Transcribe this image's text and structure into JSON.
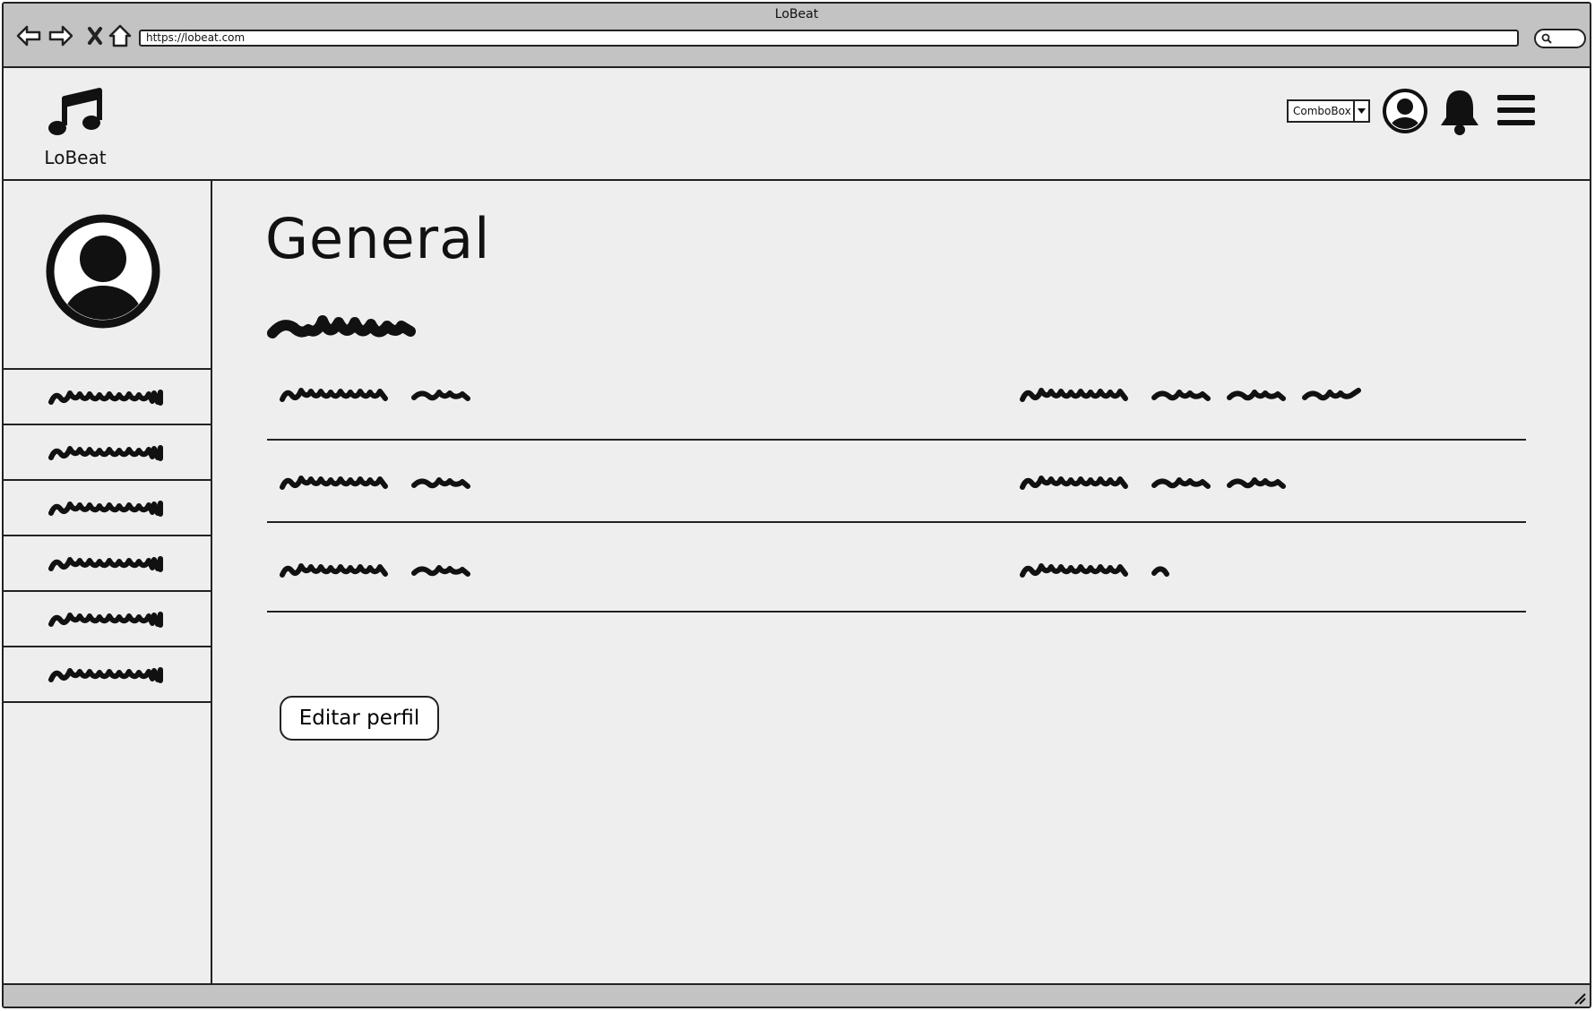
{
  "browser": {
    "title": "LoBeat",
    "url": "https://lobeat.com"
  },
  "header": {
    "logo_text": "LoBeat",
    "combobox_value": "ComboBox"
  },
  "main": {
    "title": "General",
    "edit_button": "Editar perfil"
  },
  "icons": {
    "back": "back-arrow-icon",
    "forward": "forward-arrow-icon",
    "stop": "close-icon",
    "home": "home-icon",
    "search": "search-icon",
    "logo": "music-note-icon",
    "user": "user-icon",
    "bell": "bell-icon",
    "menu": "hamburger-menu-icon",
    "dropdown": "chevron-down-icon",
    "resize": "resize-grip-icon"
  }
}
